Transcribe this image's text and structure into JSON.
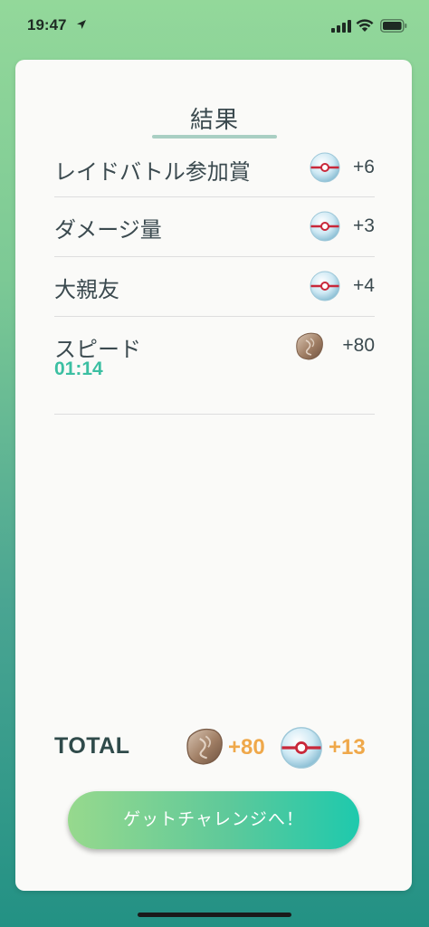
{
  "status": {
    "time": "19:47"
  },
  "result": {
    "title": "結果",
    "rows": [
      {
        "label": "レイドバトル参加賞",
        "icon": "premier-ball-icon",
        "value": "+6"
      },
      {
        "label": "ダメージ量",
        "icon": "premier-ball-icon",
        "value": "+3"
      },
      {
        "label": "大親友",
        "icon": "premier-ball-icon",
        "value": "+4"
      },
      {
        "label": "スピード",
        "icon": "rare-candy-stone-icon",
        "value": "+80",
        "sub": "01:14"
      }
    ]
  },
  "total": {
    "label": "TOTAL",
    "stone_value": "+80",
    "ball_value": "+13"
  },
  "button": {
    "label": "ゲットチャレンジへ！"
  },
  "colors": {
    "accent_text": "#3bbfa2",
    "total_value": "#efa84a",
    "button_start": "#97d98d",
    "button_end": "#1ec9ad"
  }
}
